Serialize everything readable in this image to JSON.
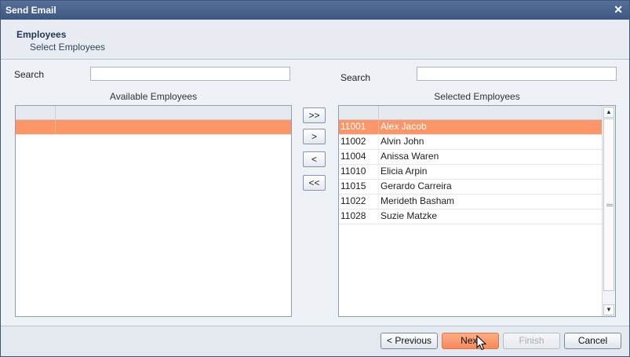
{
  "window": {
    "title": "Send Email",
    "close_glyph": "✕"
  },
  "header": {
    "title": "Employees",
    "subtitle": "Select Employees"
  },
  "left": {
    "search_label": "Search",
    "search_value": "",
    "grid_title": "Available Employees"
  },
  "right": {
    "search_label": "Search",
    "search_value": "",
    "grid_title": "Selected Employees",
    "rows": [
      {
        "id": "11001",
        "name": "Alex Jacob"
      },
      {
        "id": "11002",
        "name": "Alvin John"
      },
      {
        "id": "11004",
        "name": "Anissa Waren"
      },
      {
        "id": "11010",
        "name": "Elicia Arpin"
      },
      {
        "id": "11015",
        "name": "Gerardo Carreira"
      },
      {
        "id": "11022",
        "name": "Merideth Basham"
      },
      {
        "id": "11028",
        "name": "Suzie Matzke"
      }
    ]
  },
  "move_buttons": {
    "add_all": ">>",
    "add": ">",
    "remove": "<",
    "remove_all": "<<"
  },
  "footer": {
    "previous": "< Previous",
    "next": "Next",
    "finish": "Finish",
    "cancel": "Cancel"
  },
  "colors": {
    "selection": "#fc9668",
    "title_bar": "#4a6390",
    "primary_button": "#f58a5a"
  },
  "icons": {
    "close": "close-icon",
    "cursor": "mouse-pointer-icon",
    "scroll_up": "scroll-up-icon",
    "scroll_down": "scroll-down-icon"
  }
}
